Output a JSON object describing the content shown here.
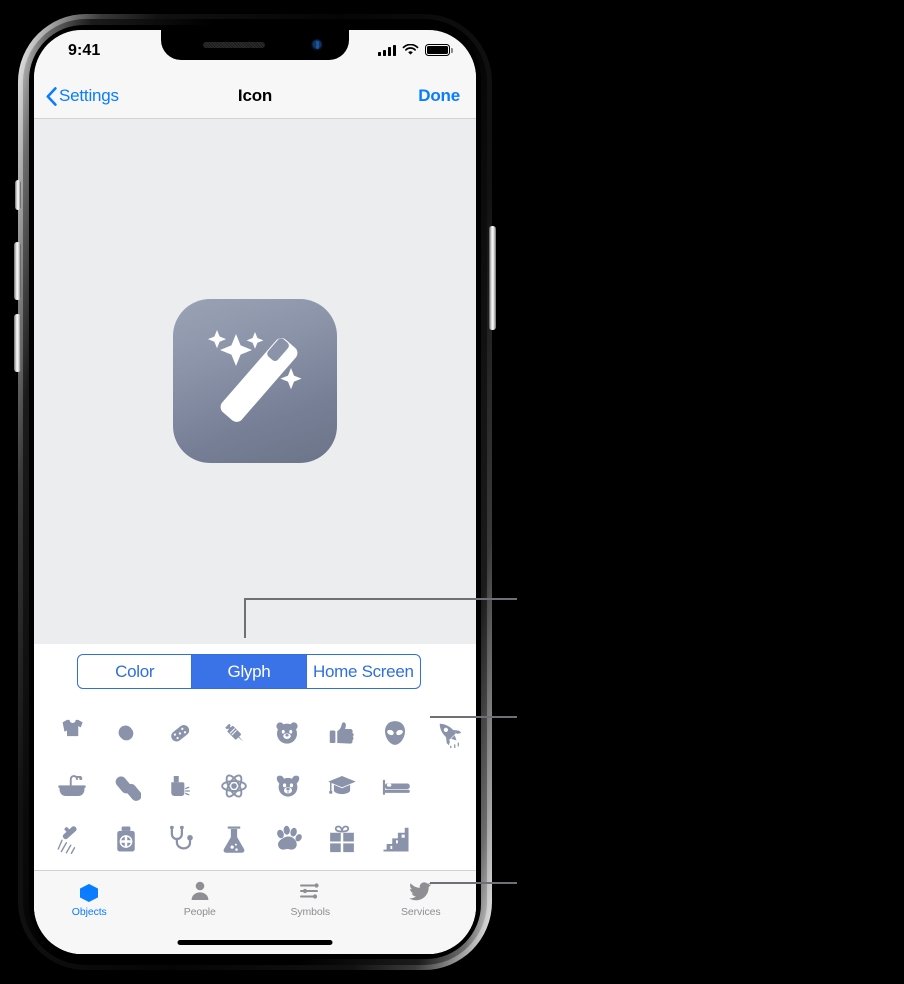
{
  "status_bar": {
    "time": "9:41",
    "signal_icon": "cellular-bars-icon",
    "wifi_icon": "wifi-icon",
    "battery_icon": "battery-full-icon"
  },
  "nav_bar": {
    "back_label": "Settings",
    "back_icon": "chevron-left-icon",
    "title": "Icon",
    "done_label": "Done"
  },
  "preview": {
    "icon_name": "magic-wand-app-icon",
    "icon_gradient_from": "#9aa3b6",
    "icon_gradient_to": "#6c7488"
  },
  "segmented_control": {
    "selected": "Glyph",
    "accent": "#3a72e8",
    "options": [
      {
        "label": "Color",
        "selected": false
      },
      {
        "label": "Glyph",
        "selected": true
      },
      {
        "label": "Home Screen",
        "selected": false
      }
    ]
  },
  "glyph_grid": {
    "color": "#8a93aa",
    "rows": [
      [
        {
          "name": "t-shirt-glyph"
        },
        {
          "name": "capsule-pill-glyph"
        },
        {
          "name": "game-controller-glyph"
        },
        {
          "name": "syringe-glyph"
        },
        {
          "name": "bear-face-glyph"
        },
        {
          "name": "thumbs-up-glyph"
        },
        {
          "name": "alien-glyph"
        },
        {
          "name": "rocket-glyph"
        }
      ],
      [
        {
          "name": "bathtub-glyph"
        },
        {
          "name": "bandage-pills-glyph"
        },
        {
          "name": "inhaler-glyph"
        },
        {
          "name": "atom-glyph"
        },
        {
          "name": "dog-face-glyph"
        },
        {
          "name": "graduation-cap-glyph"
        },
        {
          "name": "bed-glyph"
        }
      ],
      [
        {
          "name": "shower-glyph"
        },
        {
          "name": "medicine-bottle-glyph"
        },
        {
          "name": "stethoscope-glyph"
        },
        {
          "name": "flask-glyph"
        },
        {
          "name": "paw-print-glyph"
        },
        {
          "name": "gift-glyph"
        },
        {
          "name": "stairs-glyph"
        }
      ]
    ]
  },
  "tab_bar": {
    "active_color": "#0a7cff",
    "inactive_color": "#8e8e93",
    "tabs": [
      {
        "label": "Objects",
        "icon": "cube-icon",
        "selected": true
      },
      {
        "label": "People",
        "icon": "person-icon",
        "selected": false
      },
      {
        "label": "Symbols",
        "icon": "sliders-icon",
        "selected": false
      },
      {
        "label": "Services",
        "icon": "bird-icon",
        "selected": false
      }
    ]
  },
  "callouts": {
    "color": "#6e7073",
    "lines": [
      {
        "name": "callout-segmented-control"
      },
      {
        "name": "callout-glyph-row"
      },
      {
        "name": "callout-tab-bar"
      }
    ]
  }
}
